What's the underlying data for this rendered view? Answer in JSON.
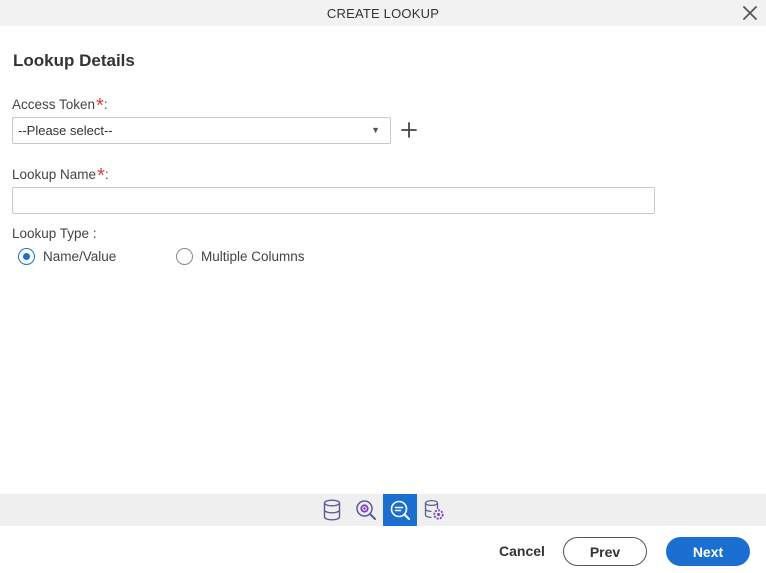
{
  "dialog": {
    "title": "CREATE LOOKUP"
  },
  "section": {
    "title": "Lookup Details"
  },
  "fields": {
    "access_token": {
      "label": "Access Token",
      "required_mark": "*",
      "suffix": ":",
      "selected": "--Please select--"
    },
    "lookup_name": {
      "label": "Lookup Name",
      "required_mark": "*",
      "suffix": ":",
      "value": "",
      "placeholder": ""
    },
    "lookup_type": {
      "label": "Lookup Type :",
      "options": [
        {
          "label": "Name/Value",
          "checked": true
        },
        {
          "label": "Multiple Columns",
          "checked": false
        }
      ]
    }
  },
  "steps": [
    {
      "icon": "database-icon",
      "active": false
    },
    {
      "icon": "lookup-settings-icon",
      "active": false
    },
    {
      "icon": "lookup-search-icon",
      "active": true
    },
    {
      "icon": "database-settings-icon",
      "active": false
    }
  ],
  "footer": {
    "cancel_label": "Cancel",
    "prev_label": "Prev",
    "next_label": "Next"
  },
  "colors": {
    "accent": "#1a6fd1",
    "required": "#e53935",
    "title_bar": "#f2f2f2",
    "step_bar": "#efefef"
  }
}
